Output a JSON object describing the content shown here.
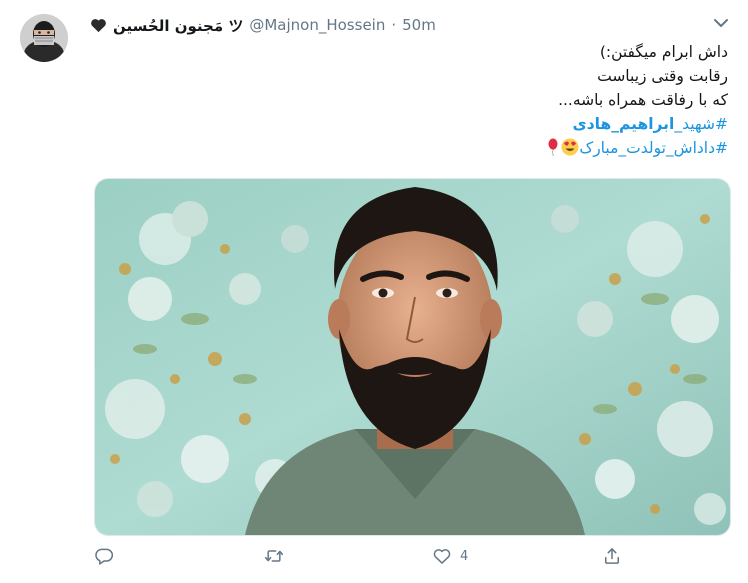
{
  "tweet": {
    "display_name": "مَجنون الحُسین ツ",
    "handle": "@Majnon_Hossein",
    "separator": "·",
    "time": "50m",
    "lines": [
      "داش ابرام میگفتن:)",
      "رقابت وقتی زیباست",
      "که با رفاقت همراه باشه..."
    ],
    "hashtag1_prefix": "#شهید_",
    "hashtag1_bold": "ابراهیم_هادی",
    "hashtag2": "#داداش_تولدت_مبارک",
    "like_count": "4"
  },
  "icons": {
    "badge": "black-heart-icon",
    "menu": "chevron-down-icon",
    "emoji1": "heart-eyes-emoji-icon",
    "emoji2": "balloon-emoji-icon",
    "reply": "reply-icon",
    "retweet": "retweet-icon",
    "like": "like-heart-icon",
    "share": "share-icon"
  },
  "colors": {
    "link": "#1b95e0",
    "muted": "#657786",
    "text": "#14171a"
  }
}
